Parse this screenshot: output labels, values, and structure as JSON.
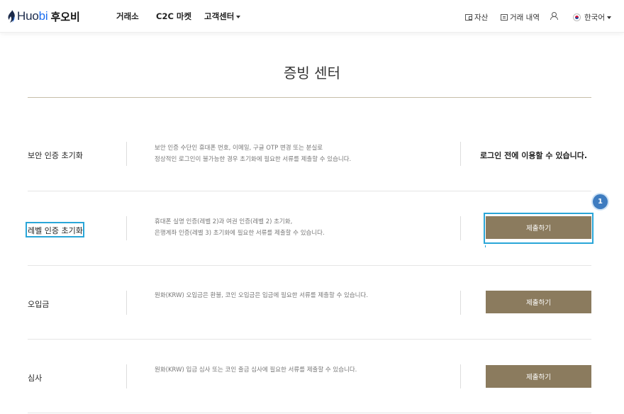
{
  "header": {
    "logo_text_a": "Huo",
    "logo_text_b": "bi",
    "logo_korean": "후오비",
    "nav": [
      "거래소",
      "C2C 마켓",
      "고객센터"
    ],
    "asset": "자산",
    "orders": "거래 내역",
    "language": "한국어"
  },
  "title": "증빙 센터",
  "rows": [
    {
      "label": "보안 인증 초기화",
      "desc": [
        "보안 인증 수단인 휴대폰 번호, 이메일, 구글 OTP 변경 또는 분실로",
        "정상적인 로그인이 불가능한 경우 초기화에 필요한 서류를 제출할 수 있습니다."
      ],
      "note": "로그인 전에 이용할 수 있습니다."
    },
    {
      "label": "레벨 인증 초기화",
      "desc": [
        "휴대폰 실명 인증(레벨 2)과 여권 인증(레벨 2) 초기화,",
        "은행계좌 인증(레벨 3) 초기화에 필요한 서류를 제출할 수 있습니다."
      ],
      "button": "제출하기"
    },
    {
      "label": "오입금",
      "desc": [
        "원화(KRW) 오입금은 환불, 코인 오입금은 입금에 필요한 서류를 제출할 수 있습니다."
      ],
      "button": "제출하기"
    },
    {
      "label": "심사",
      "desc": [
        "원화(KRW) 입금 심사 또는 코인 출금 심사에 필요한 서류를 제출할 수 있습니다."
      ],
      "button": "제출하기"
    }
  ],
  "annotation": {
    "badge": "1"
  },
  "colors": {
    "button": "#8b7b5e",
    "highlight": "#2aa6d8",
    "badge": "#3e7cc0",
    "rule": "#c7bea8"
  }
}
